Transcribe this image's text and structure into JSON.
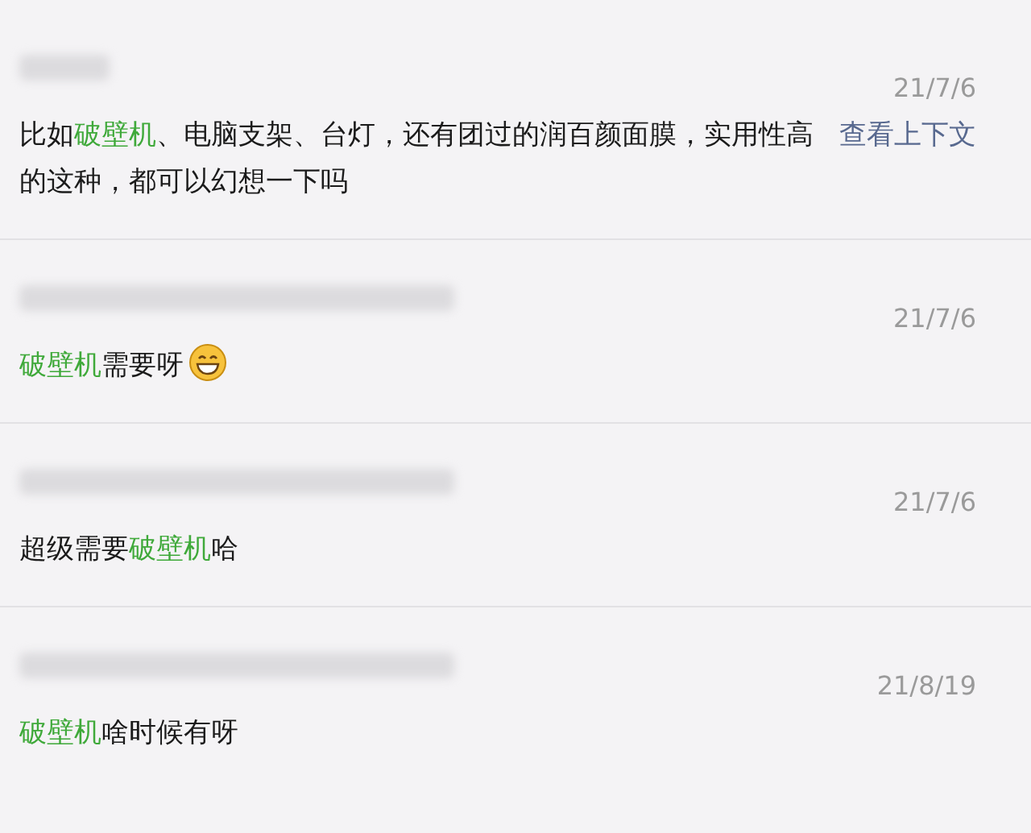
{
  "comments": [
    {
      "date": "21/7/6",
      "message": [
        {
          "text": "比如",
          "highlight": false
        },
        {
          "text": "破壁机",
          "highlight": true
        },
        {
          "text": "、电脑支架、台灯，还有团过的润百颜面膜，实用性高的这种，都可以幻想一下吗",
          "highlight": false
        }
      ],
      "context_link": "查看上下文"
    },
    {
      "date": "21/7/6",
      "message": [
        {
          "text": "破壁机",
          "highlight": true
        },
        {
          "text": "需要呀",
          "highlight": false
        }
      ],
      "emoji": true
    },
    {
      "date": "21/7/6",
      "message": [
        {
          "text": "超级需要",
          "highlight": false
        },
        {
          "text": "破壁机",
          "highlight": true
        },
        {
          "text": "哈",
          "highlight": false
        }
      ]
    },
    {
      "date": "21/8/19",
      "message": [
        {
          "text": "破壁机",
          "highlight": true
        },
        {
          "text": "啥时候有呀",
          "highlight": false
        }
      ]
    }
  ]
}
